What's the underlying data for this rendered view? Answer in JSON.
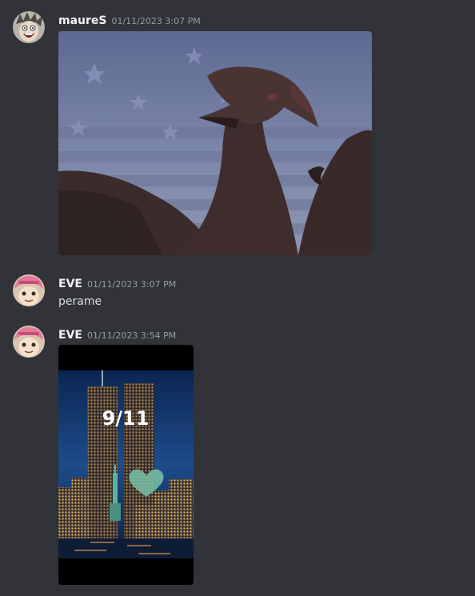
{
  "messages": [
    {
      "author": "maureS",
      "timestamp": "01/11/2023 3:07 PM",
      "avatar_icon": "anime-face-avatar",
      "attachment": {
        "type": "gif",
        "subject": "kaiju bird creature in front of american flag"
      }
    },
    {
      "author": "EVE",
      "timestamp": "01/11/2023 3:07 PM",
      "avatar_icon": "pink-hair-avatar",
      "text": "perame"
    },
    {
      "author": "EVE",
      "timestamp": "01/11/2023 3:54 PM",
      "avatar_icon": "pink-hair-avatar",
      "attachment": {
        "type": "image",
        "subject": "twin towers night skyline",
        "overlay_text": "9/11"
      }
    }
  ],
  "colors": {
    "background": "#313338",
    "username": "#f2f3f5",
    "timestamp": "#949ba4",
    "text": "#dbdee1"
  }
}
